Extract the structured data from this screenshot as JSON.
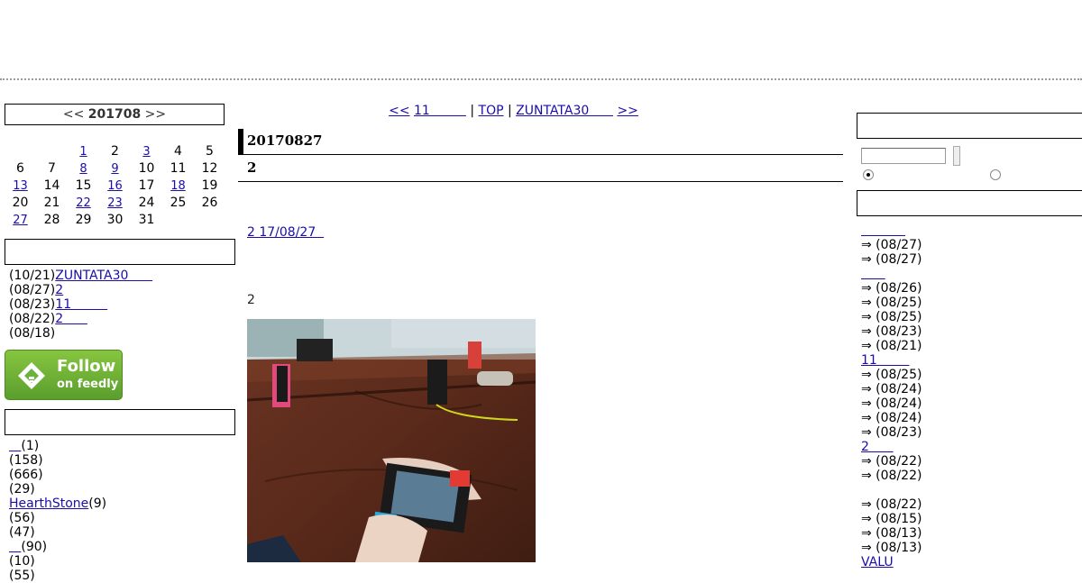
{
  "left": {
    "calendar": {
      "prev": "<<",
      "month": "201708",
      "next": ">>",
      "rows": [
        [
          {
            "t": ""
          },
          {
            "t": ""
          },
          {
            "t": "1",
            "link": true
          },
          {
            "t": "2"
          },
          {
            "t": "3",
            "link": true
          },
          {
            "t": "4"
          },
          {
            "t": "5"
          }
        ],
        [
          {
            "t": "6"
          },
          {
            "t": "7"
          },
          {
            "t": "8",
            "link": true
          },
          {
            "t": "9",
            "link": true
          },
          {
            "t": "10"
          },
          {
            "t": "11"
          },
          {
            "t": "12"
          }
        ],
        [
          {
            "t": "13",
            "link": true
          },
          {
            "t": "14"
          },
          {
            "t": "15"
          },
          {
            "t": "16",
            "link": true
          },
          {
            "t": "17"
          },
          {
            "t": "18",
            "link": true
          },
          {
            "t": "19"
          }
        ],
        [
          {
            "t": "20"
          },
          {
            "t": "21"
          },
          {
            "t": "22",
            "link": true
          },
          {
            "t": "23",
            "link": true
          },
          {
            "t": "24"
          },
          {
            "t": "25"
          },
          {
            "t": "26"
          }
        ],
        [
          {
            "t": "27",
            "link": true
          },
          {
            "t": "28"
          },
          {
            "t": "29"
          },
          {
            "t": "30"
          },
          {
            "t": "31"
          },
          {
            "t": ""
          },
          {
            "t": ""
          }
        ]
      ]
    },
    "recent": [
      {
        "date": "(10/21)",
        "link": "ZUNTATA30      "
      },
      {
        "date": "(08/27)",
        "link": "2"
      },
      {
        "date": "(08/23)",
        "link": "11         "
      },
      {
        "date": "(08/22)",
        "link": "2      "
      },
      {
        "date": "(08/18)",
        "link": ""
      }
    ],
    "feedly": {
      "line1": "Follow",
      "line2": "on feedly",
      "color": "#6cb33e"
    },
    "categories": [
      {
        "link": "   ",
        "count": "(1)"
      },
      {
        "link": "",
        "count": "(158)"
      },
      {
        "link": "",
        "count": "(666)"
      },
      {
        "link": "",
        "count": "(29)"
      },
      {
        "link": "HearthStone",
        "count": "(9)"
      },
      {
        "link": "",
        "count": "(56)"
      },
      {
        "link": "",
        "count": "(47)"
      },
      {
        "link": "   ",
        "count": "(90)"
      },
      {
        "link": "",
        "count": "(10)"
      },
      {
        "link": "",
        "count": "(55)"
      }
    ]
  },
  "center": {
    "nav": {
      "prev": "<<",
      "prev_title": "11         ",
      "sep1": " | ",
      "top": "TOP",
      "sep2": " | ",
      "next_title": "ZUNTATA30      ",
      "next": ">>"
    },
    "date": "20170827",
    "title": "2",
    "post_link": "2 17/08/27  ",
    "post_text": "2"
  },
  "right": {
    "groups": [
      {
        "head": "           ",
        "items": [
          "⇒  (08/27)",
          "⇒  (08/27)"
        ]
      },
      {
        "head": "      ",
        "items": [
          "⇒   (08/26)",
          "⇒   (08/25)",
          "⇒   (08/25)",
          "⇒   (08/23)",
          "⇒   (08/21)"
        ]
      },
      {
        "head": "11        ",
        "items": [
          "⇒   (08/25)",
          "⇒   (08/24)",
          "⇒   (08/24)",
          "⇒  (08/24)",
          "⇒   (08/23)"
        ]
      },
      {
        "head": "2      ",
        "items": [
          "⇒   (08/22)",
          "⇒   (08/22)"
        ]
      },
      {
        "head": "",
        "items": [
          "⇒   (08/22)",
          "⇒   (08/15)",
          "⇒  (08/13)",
          "⇒   (08/13)"
        ]
      },
      {
        "head": "VALU",
        "items": []
      }
    ]
  }
}
